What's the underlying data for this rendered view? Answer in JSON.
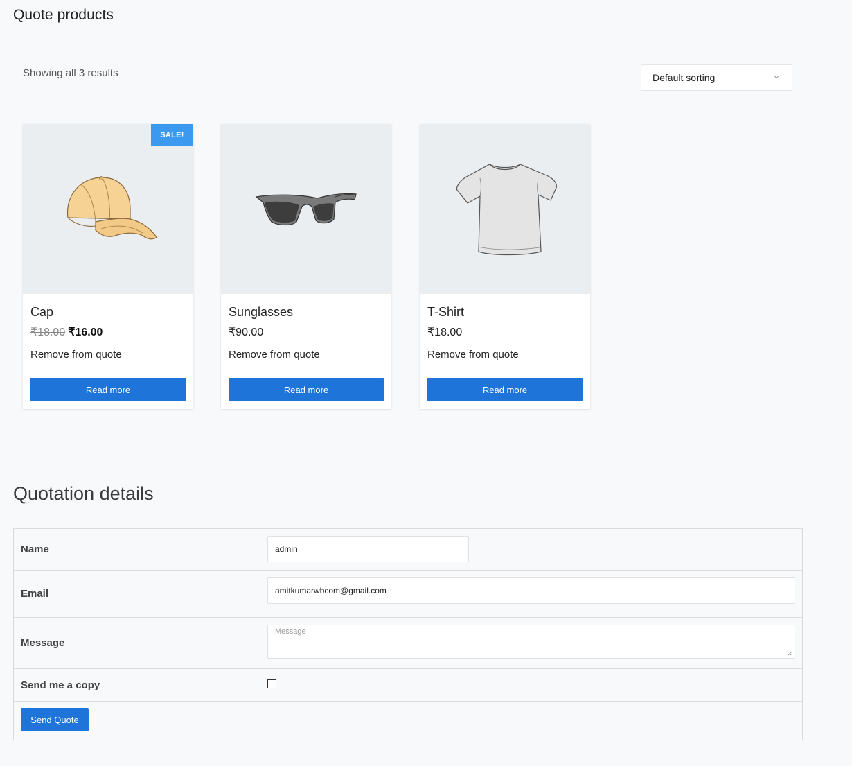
{
  "page": {
    "title": "Quote products"
  },
  "toolbar": {
    "result_count": "Showing all 3 results",
    "sorting": "Default sorting"
  },
  "products": [
    {
      "name": "Cap",
      "sale_badge": "SALE!",
      "old_price": "₹18.00",
      "price": "₹16.00",
      "remove_label": "Remove from quote",
      "button_label": "Read more",
      "image": "cap-image"
    },
    {
      "name": "Sunglasses",
      "price": "₹90.00",
      "remove_label": "Remove from quote",
      "button_label": "Read more",
      "image": "sunglasses-image"
    },
    {
      "name": "T-Shirt",
      "price": "₹18.00",
      "remove_label": "Remove from quote",
      "button_label": "Read more",
      "image": "tshirt-image"
    }
  ],
  "quotation": {
    "title": "Quotation details",
    "name_label": "Name",
    "name_value": "admin",
    "email_label": "Email",
    "email_value": "amitkumarwbcom@gmail.com",
    "message_label": "Message",
    "message_placeholder": "Message",
    "copy_label": "Send me a copy",
    "copy_checked": false,
    "send_label": "Send Quote"
  },
  "colors": {
    "accent": "#1e74d9",
    "sale_badge": "#3b9af0",
    "thumb_bg": "#ebeef1",
    "page_bg": "#f8f9fb"
  }
}
